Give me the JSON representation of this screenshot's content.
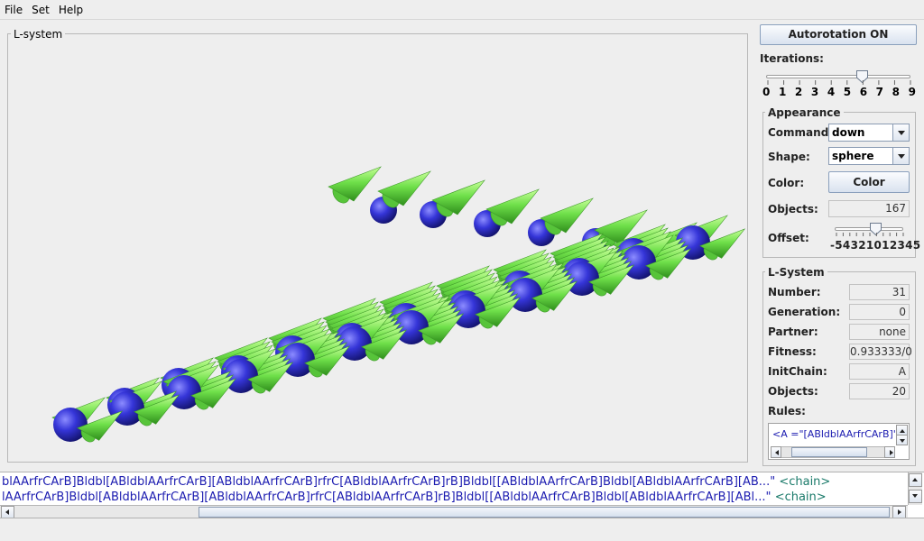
{
  "menu": [
    "File",
    "Set",
    "Help"
  ],
  "lsystem_panel": {
    "title": "L-system"
  },
  "autorotation_button": "Autorotation ON",
  "iterations": {
    "label": "Iterations:",
    "value": 6,
    "ticks": [
      "0",
      "1",
      "2",
      "3",
      "4",
      "5",
      "6",
      "7",
      "8",
      "9"
    ]
  },
  "appearance": {
    "title": "Appearance",
    "command_label": "Command:",
    "command_value": "down",
    "shape_label": "Shape:",
    "shape_value": "sphere",
    "color_label": "Color:",
    "color_button": "Color",
    "objects_label": "Objects:",
    "objects_value": "167",
    "offset_label": "Offset:",
    "offset_ticks": "-54321012345",
    "offset_value": 1
  },
  "lsystem_info": {
    "title": "L-System",
    "number_label": "Number:",
    "number_value": "31",
    "generation_label": "Generation:",
    "generation_value": "0",
    "partner_label": "Partner:",
    "partner_value": "none",
    "fitness_label": "Fitness:",
    "fitness_value": "0.933333/0",
    "initchain_label": "InitChain:",
    "initchain_value": "A",
    "objects_label": "Objects:",
    "objects_value": "20",
    "rules_label": "Rules:",
    "rules_text": "<A =\"[ABldblAArfrCArB]\"/>"
  },
  "chain": {
    "line1": "blAArfrCArB]Bldbl[ABldblAArfrCArB][ABldblAArfrCArB]rfrC[ABldblAArfrCArB]rB]Bldbl[[ABldblAArfrCArB]Bldbl[ABldblAArfrCArB][AB...\"",
    "line2": "lAArfrCArB]Bldbl[ABldblAArfrCArB][ABldblAArfrCArB]rfrC[ABldblAArfrCArB]rB]Bldbl[[ABldblAArfrCArB]Bldbl[ABldblAArfrCArB][ABl...\"",
    "tag": "<chain>"
  },
  "colors": {
    "cone": "#6fe04a",
    "sphere": "#3535d8",
    "accent": "#1b1bb0"
  }
}
